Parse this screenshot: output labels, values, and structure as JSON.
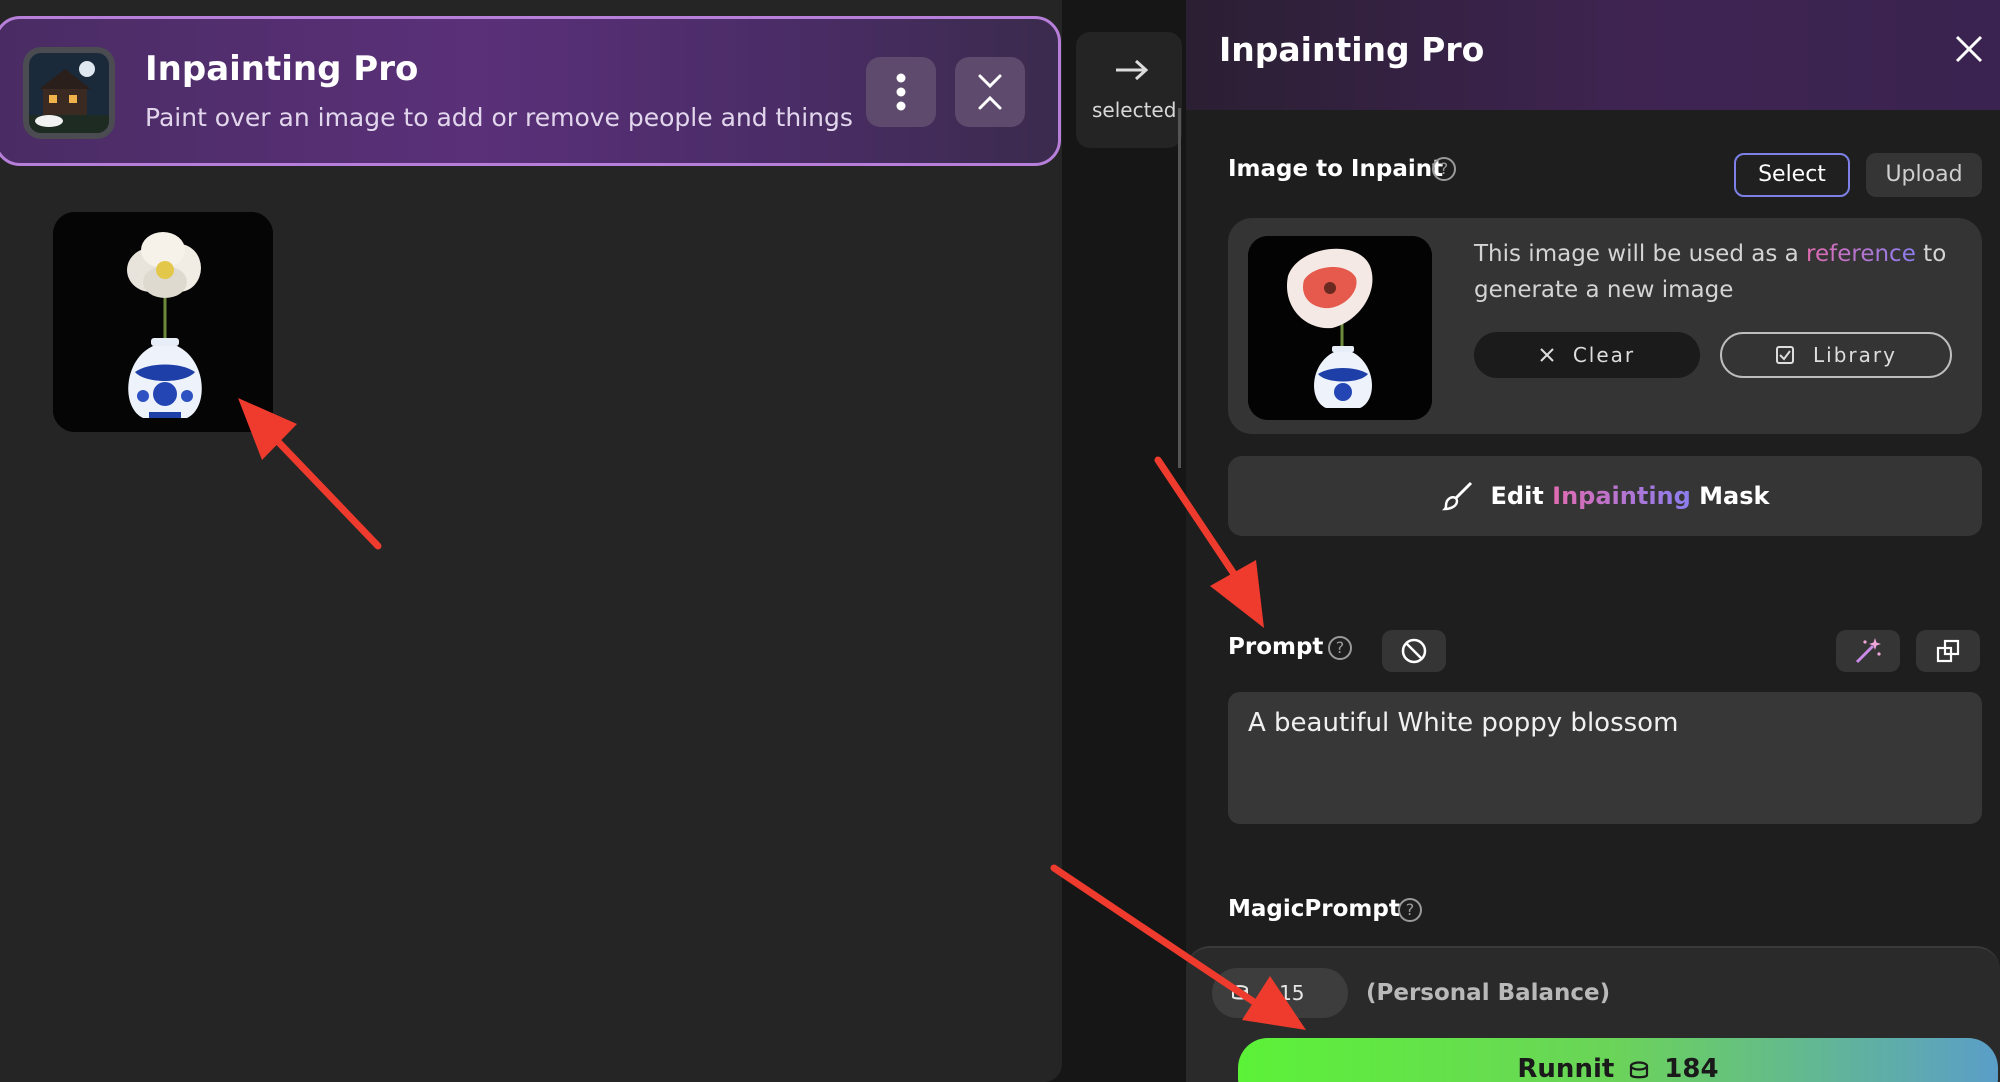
{
  "app_header": {
    "title": "Inpainting Pro",
    "subtitle": "Paint over an image to add or remove people and things"
  },
  "middle": {
    "selected_label": "selected"
  },
  "right_panel": {
    "title": "Inpainting Pro",
    "image_section": {
      "label": "Image to Inpaint",
      "select_label": "Select",
      "upload_label": "Upload",
      "ref_text_before": "This image will be used as a ",
      "ref_keyword": "reference",
      "ref_text_after": " to generate a new image",
      "clear_label": "Clear",
      "library_label": "Library"
    },
    "edit_mask": {
      "prefix": "Edit ",
      "keyword": "Inpainting",
      "suffix": " Mask"
    },
    "prompt": {
      "label": "Prompt",
      "value": "A beautiful White poppy blossom"
    },
    "magic_prompt": {
      "label": "MagicPrompt"
    }
  },
  "footer": {
    "balance_value": ".815",
    "balance_label": "(Personal Balance)",
    "runnit_label": "Runnit",
    "runnit_cost": "184"
  },
  "colors": {
    "header_border": "#b77fd9",
    "select_border": "#7d80e6",
    "keyword_gradient_start": "#e06bb0",
    "keyword_gradient_end": "#8b7ef0",
    "runnit_green": "#5cf238",
    "annotation_arrow": "#ef3b2d"
  },
  "icons": [
    "app-thumbnail",
    "more-vertical-icon",
    "collapse-icon",
    "arrow-right-icon",
    "close-icon",
    "help-icon",
    "clear-x-icon",
    "checkbox-icon",
    "brush-icon",
    "disable-icon",
    "magic-wand-icon",
    "expand-icon",
    "coin-icon"
  ]
}
